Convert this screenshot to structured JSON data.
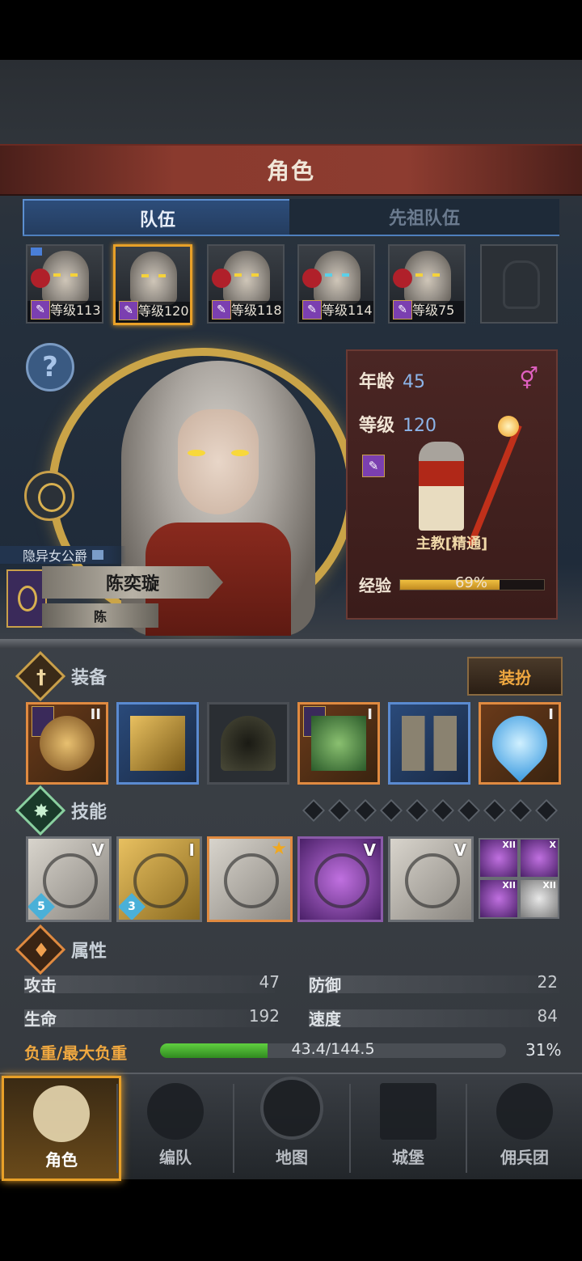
{
  "header": {
    "title": "角色"
  },
  "tabs": [
    {
      "label": "队伍",
      "active": true
    },
    {
      "label": "先祖队伍",
      "active": false
    }
  ],
  "roster": [
    {
      "level": "等级113",
      "selected": false
    },
    {
      "level": "等级120",
      "selected": true
    },
    {
      "level": "等级118",
      "selected": false
    },
    {
      "level": "等级114",
      "selected": false
    },
    {
      "level": "等级75",
      "selected": false
    }
  ],
  "roster_badge_glyph": "✎",
  "help_glyph": "?",
  "character": {
    "title": "隐异女公爵",
    "name": "陈奕璇",
    "surname": "陈"
  },
  "info": {
    "age_label": "年龄",
    "age": "45",
    "gender_glyph": "⚥",
    "level_label": "等级",
    "level": "120",
    "class_name": "主教[精通]",
    "exp_label": "经验",
    "exp_pct_text": "69%",
    "exp_fraction": 0.69
  },
  "equipment": {
    "section_label": "装备",
    "section_glyph": "†",
    "dress_button": "装扮",
    "slots": [
      {
        "roman": "II",
        "style": "gold",
        "flag": true
      },
      {
        "roman": "",
        "style": "blue",
        "flag": false
      },
      {
        "roman": "",
        "style": "plain",
        "flag": false
      },
      {
        "roman": "I",
        "style": "gold",
        "flag": true
      },
      {
        "roman": "",
        "style": "blue",
        "flag": false
      },
      {
        "roman": "I",
        "style": "gold",
        "flag": false
      }
    ]
  },
  "skills": {
    "section_label": "技能",
    "section_glyph": "✸",
    "items": [
      {
        "roman": "V",
        "level": "5",
        "style": "plain"
      },
      {
        "roman": "I",
        "level": "3",
        "style": "gold"
      },
      {
        "roman": "★",
        "level": "",
        "style": "orange"
      },
      {
        "roman": "V",
        "level": "",
        "style": "purple"
      },
      {
        "roman": "V",
        "level": "",
        "style": "plain"
      }
    ],
    "mini": [
      {
        "roman": "XII",
        "style": "purple"
      },
      {
        "roman": "X",
        "style": "purple"
      },
      {
        "roman": "XII",
        "style": "purple"
      },
      {
        "roman": "XII",
        "style": "grey"
      }
    ]
  },
  "attributes": {
    "section_label": "属性",
    "section_glyph": "♦",
    "attack_label": "攻击",
    "attack": "47",
    "defense_label": "防御",
    "defense": "22",
    "hp_label": "生命",
    "hp": "192",
    "speed_label": "速度",
    "speed": "84",
    "load_label": "负重/最大负重",
    "load_text": "43.4/144.5",
    "load_pct": "31%",
    "load_fraction": 0.31
  },
  "nav": [
    {
      "label": "角色",
      "active": true
    },
    {
      "label": "编队",
      "active": false
    },
    {
      "label": "地图",
      "active": false
    },
    {
      "label": "城堡",
      "active": false
    },
    {
      "label": "佣兵团",
      "active": false
    }
  ],
  "colors": {
    "accent": "#e8a028",
    "tab_blue": "#5c8fd0",
    "exp_gold": "#f0c040",
    "load_green": "#60d040"
  }
}
